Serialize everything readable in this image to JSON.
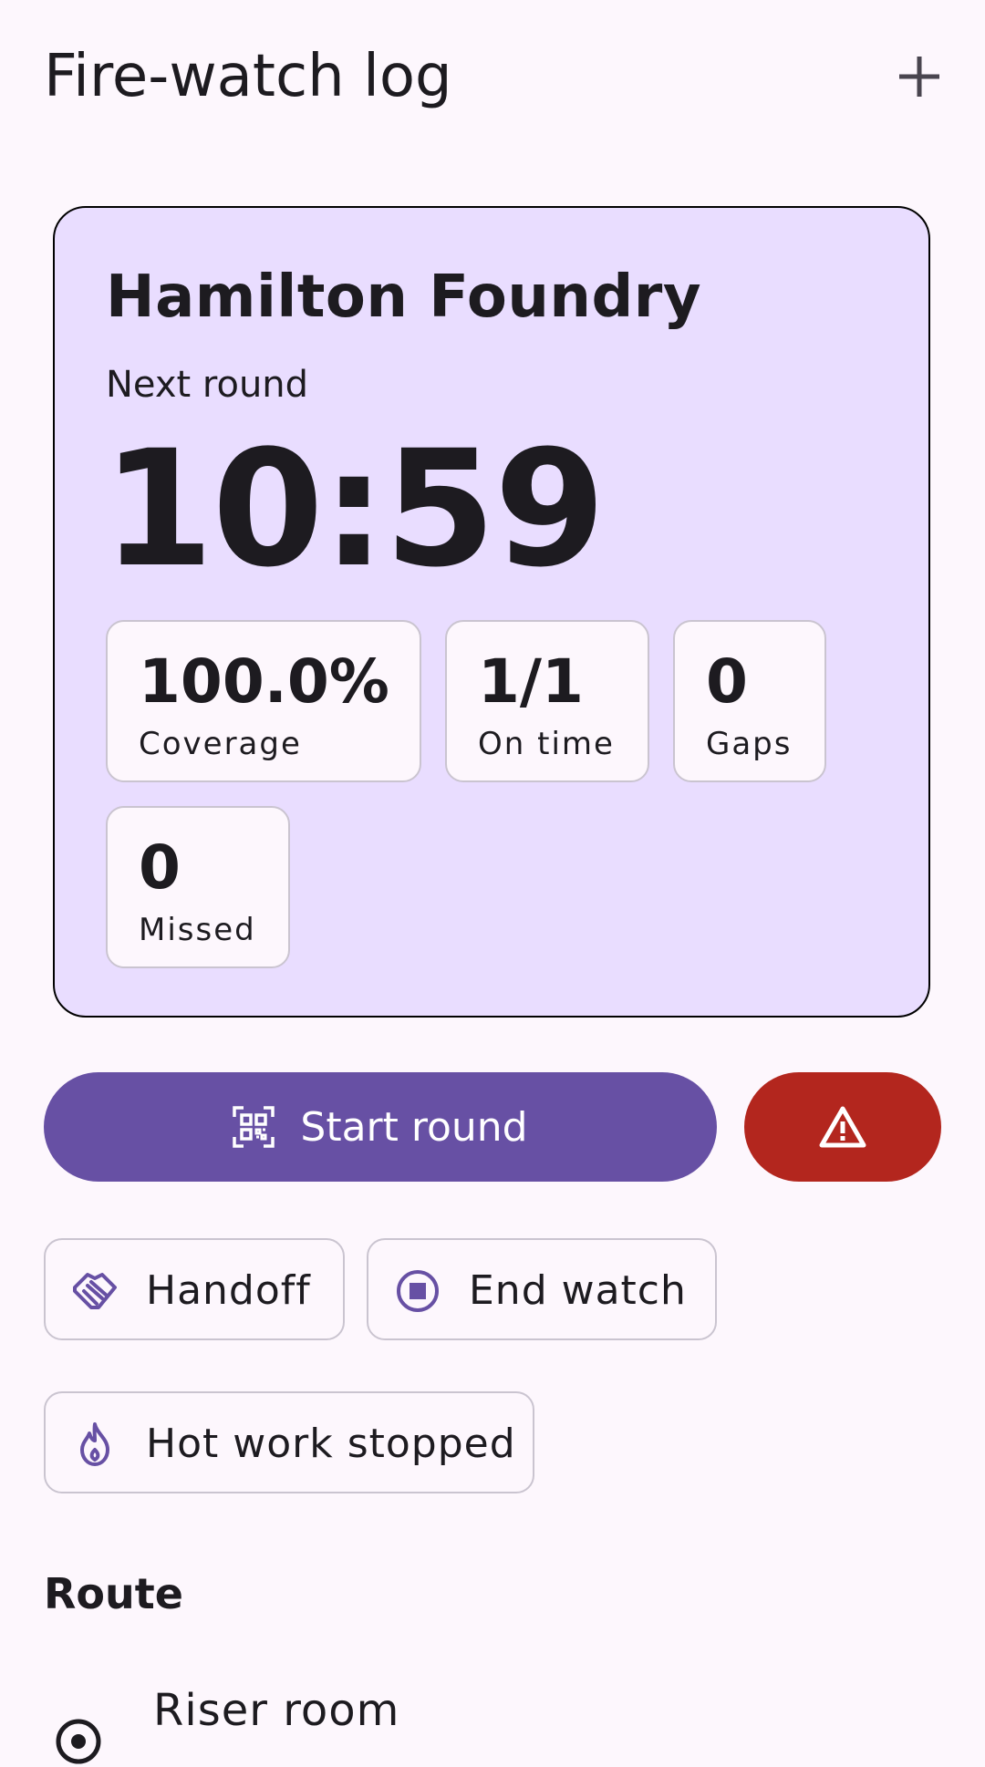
{
  "header": {
    "title": "Fire-watch log",
    "add_icon": "plus-icon"
  },
  "watch_card": {
    "site": "Hamilton Foundry",
    "next_round_label": "Next round",
    "countdown": "10:59",
    "stats": [
      {
        "value": "100.0%",
        "label": "Coverage"
      },
      {
        "value": "1/1",
        "label": "On time"
      },
      {
        "value": "0",
        "label": "Gaps"
      },
      {
        "value": "0",
        "label": "Missed"
      }
    ]
  },
  "actions": {
    "start_round": {
      "label": "Start round",
      "icon": "qr-scan-icon"
    },
    "alert": {
      "icon": "warning-icon"
    },
    "handoff": {
      "label": "Handoff",
      "icon": "handshake-icon"
    },
    "end_watch": {
      "label": "End watch",
      "icon": "stop-circle-icon"
    },
    "hot_work_stopped": {
      "label": "Hot work stopped",
      "icon": "flame-icon"
    }
  },
  "route": {
    "title": "Route",
    "items": [
      {
        "name": "Riser room",
        "icon": "location-target-icon"
      }
    ]
  },
  "colors": {
    "background": "#fdf7fd",
    "card": "#e9ddff",
    "primary": "#6750a4",
    "danger": "#b3261e",
    "outline": "#cac4d0"
  }
}
